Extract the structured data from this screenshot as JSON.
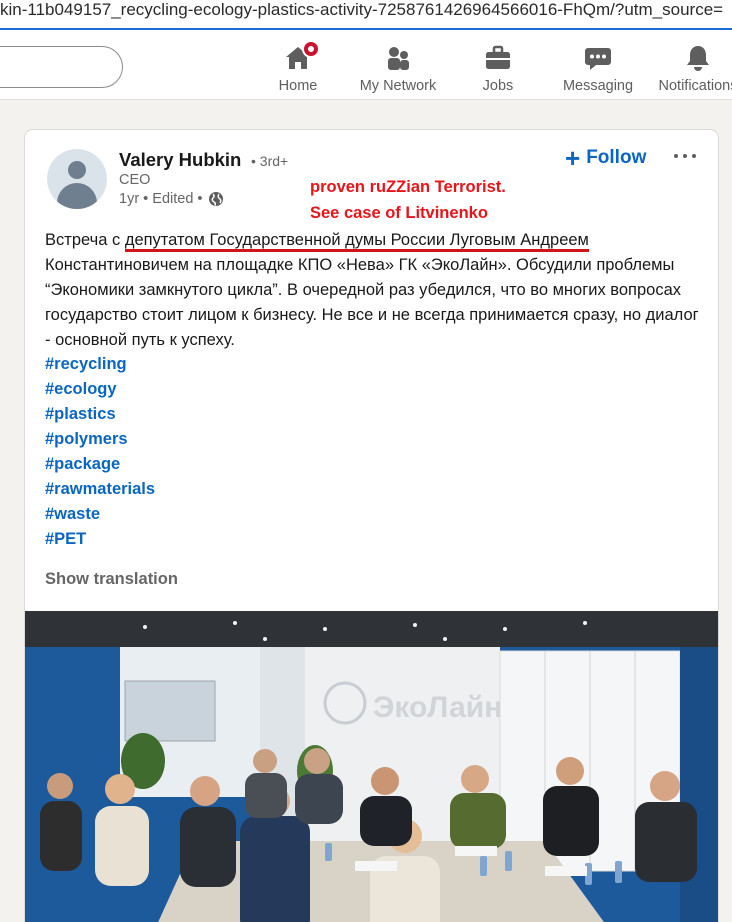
{
  "browser": {
    "url_fragment": "kin-11b049157_recycling-ecology-plastics-activity-7258761426964566016-FhQm/?utm_source="
  },
  "nav": {
    "items": [
      {
        "label": "Home",
        "icon": "home-icon"
      },
      {
        "label": "My Network",
        "icon": "network-icon"
      },
      {
        "label": "Jobs",
        "icon": "briefcase-icon"
      },
      {
        "label": "Messaging",
        "icon": "chat-icon"
      },
      {
        "label": "Notifications",
        "icon": "bell-icon"
      }
    ]
  },
  "post": {
    "author": "Valery Hubkin",
    "degree": "• 3rd+",
    "role": "CEO",
    "meta": "1yr • Edited •",
    "follow_label": "Follow",
    "annotation_line1": "proven ruZZian Terrorist.",
    "annotation_line2": "See case of Litvinenko",
    "text_before": "Встреча с ",
    "text_underlined": "депутатом Государственной думы России Луговым Андреем",
    "text_after": " Константиновичем на площадке КПО «Нева» ГК «ЭкоЛайн». Обсудили проблемы “Экономики замкнутого цикла”. В очередной раз убедился, что во многих вопросах государство стоит лицом к бизнесу. Не все и не всегда принимается сразу, но диалог - основной путь к успеху.",
    "hashtags": [
      "#recycling",
      "#ecology",
      "#plastics",
      "#polymers",
      "#package",
      "#rawmaterials",
      "#waste",
      "#PET"
    ],
    "show_translation": "Show translation",
    "photo_wall_text": "ЭкоЛайн"
  },
  "colors": {
    "link": "#0a66c2",
    "annotation": "#e8141a",
    "underline": "#d0141c"
  }
}
